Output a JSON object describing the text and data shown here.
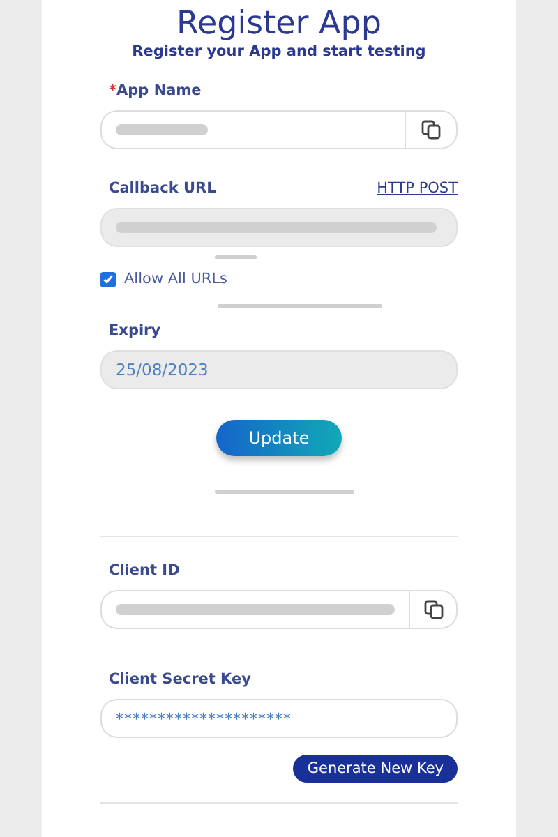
{
  "title": "Register App",
  "subtitle": "Register your App and start testing",
  "app_name": {
    "label": "App Name",
    "required_mark": "*"
  },
  "callback_url": {
    "label": "Callback URL",
    "link": "HTTP POST"
  },
  "allow_all_urls": {
    "label": "Allow All URLs",
    "checked": true
  },
  "expiry": {
    "label": "Expiry",
    "value": "25/08/2023"
  },
  "update_button": "Update",
  "client_id": {
    "label": "Client ID"
  },
  "client_secret": {
    "label": "Client Secret Key",
    "value": "*********************"
  },
  "generate_button": "Generate New Key"
}
